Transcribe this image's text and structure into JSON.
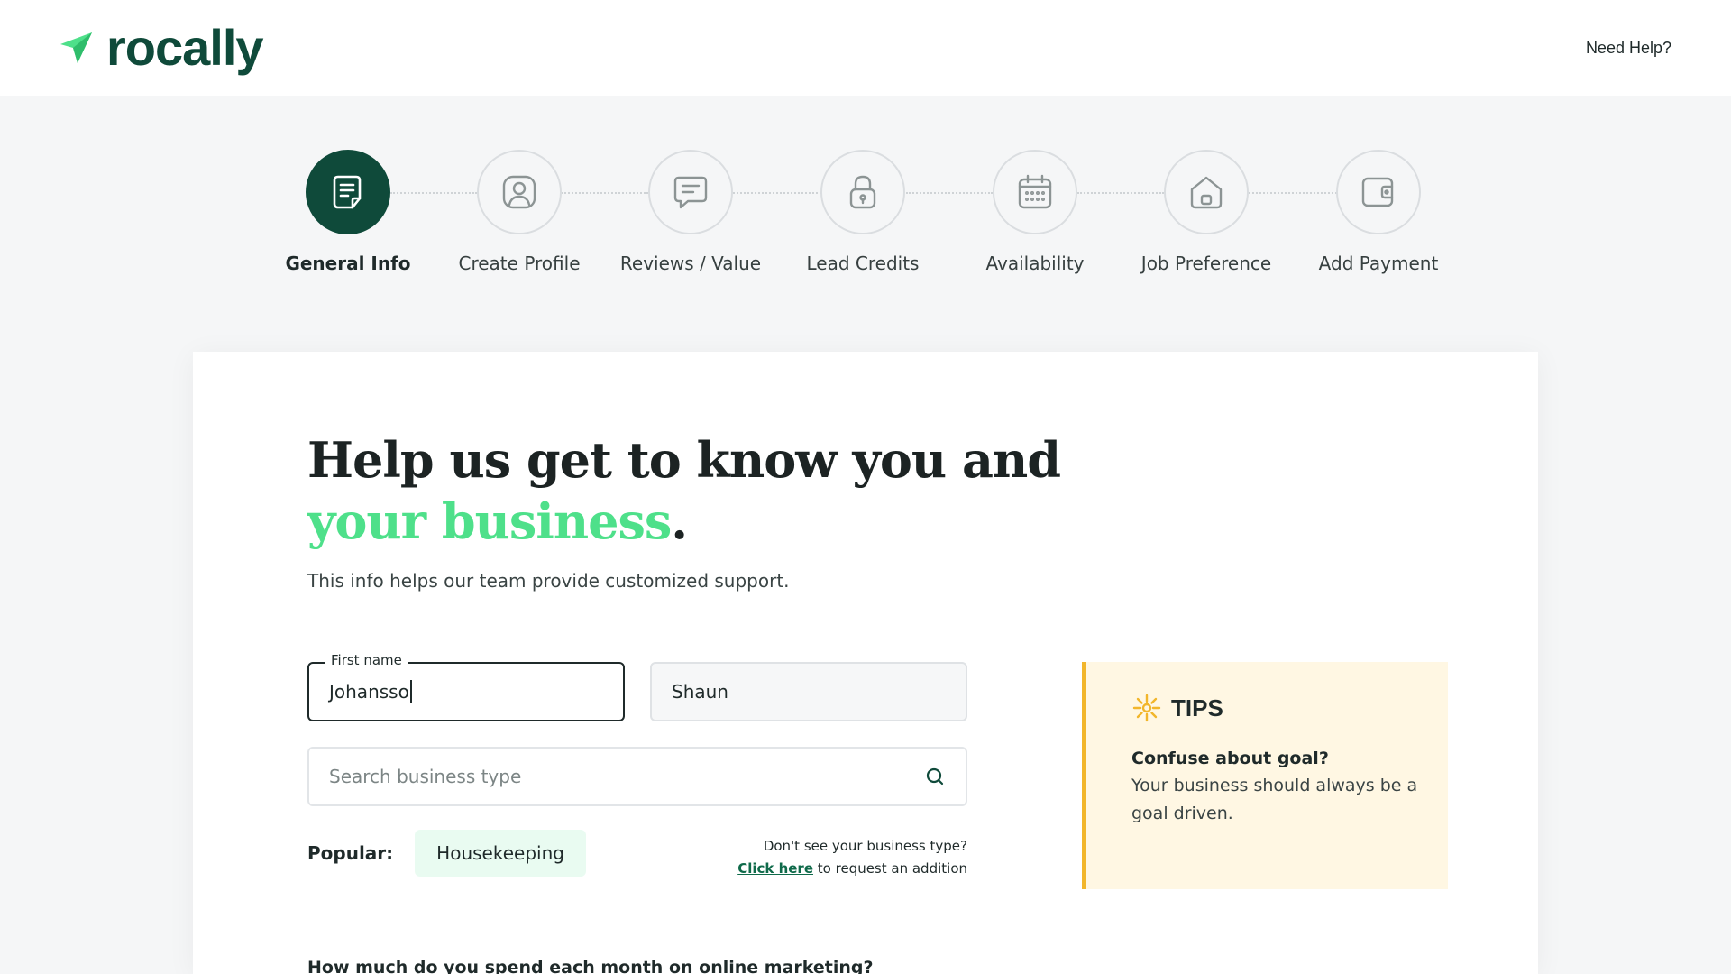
{
  "header": {
    "brand": "rocally",
    "help_label": "Need Help?"
  },
  "stepper": {
    "steps": [
      {
        "label": "General Info",
        "icon": "document-icon",
        "active": true
      },
      {
        "label": "Create Profile",
        "icon": "profile-icon",
        "active": false
      },
      {
        "label": "Reviews / Value",
        "icon": "message-icon",
        "active": false
      },
      {
        "label": "Lead Credits",
        "icon": "lock-icon",
        "active": false
      },
      {
        "label": "Availability",
        "icon": "calendar-icon",
        "active": false
      },
      {
        "label": "Job Preference",
        "icon": "home-icon",
        "active": false
      },
      {
        "label": "Add Payment",
        "icon": "wallet-icon",
        "active": false
      }
    ]
  },
  "main": {
    "headline_line1": "Help us get to know you and",
    "headline_accent": "your business",
    "headline_period": ".",
    "subtitle": "This info helps our team provide customized support.",
    "first_name": {
      "label": "First name",
      "value": "Johansso"
    },
    "last_name": {
      "value": "Shaun"
    },
    "search": {
      "placeholder": "Search business type"
    },
    "popular_label": "Popular:",
    "popular_chips": [
      "Housekeeping"
    ],
    "request_question": "Don't see your business type?",
    "request_link": "Click here",
    "request_suffix": "to request an addition",
    "next_question": "How much do you spend each month on online marketing?"
  },
  "tips": {
    "title": "TIPS",
    "heading": "Confuse about goal?",
    "body": "Your business should always be a goal driven."
  },
  "colors": {
    "brand_dark": "#0f4a3a",
    "brand_accent": "#4ee08a",
    "tips_bg": "#fff7e3",
    "tips_border": "#f2b62b",
    "chip_bg": "#e9fbf1"
  }
}
